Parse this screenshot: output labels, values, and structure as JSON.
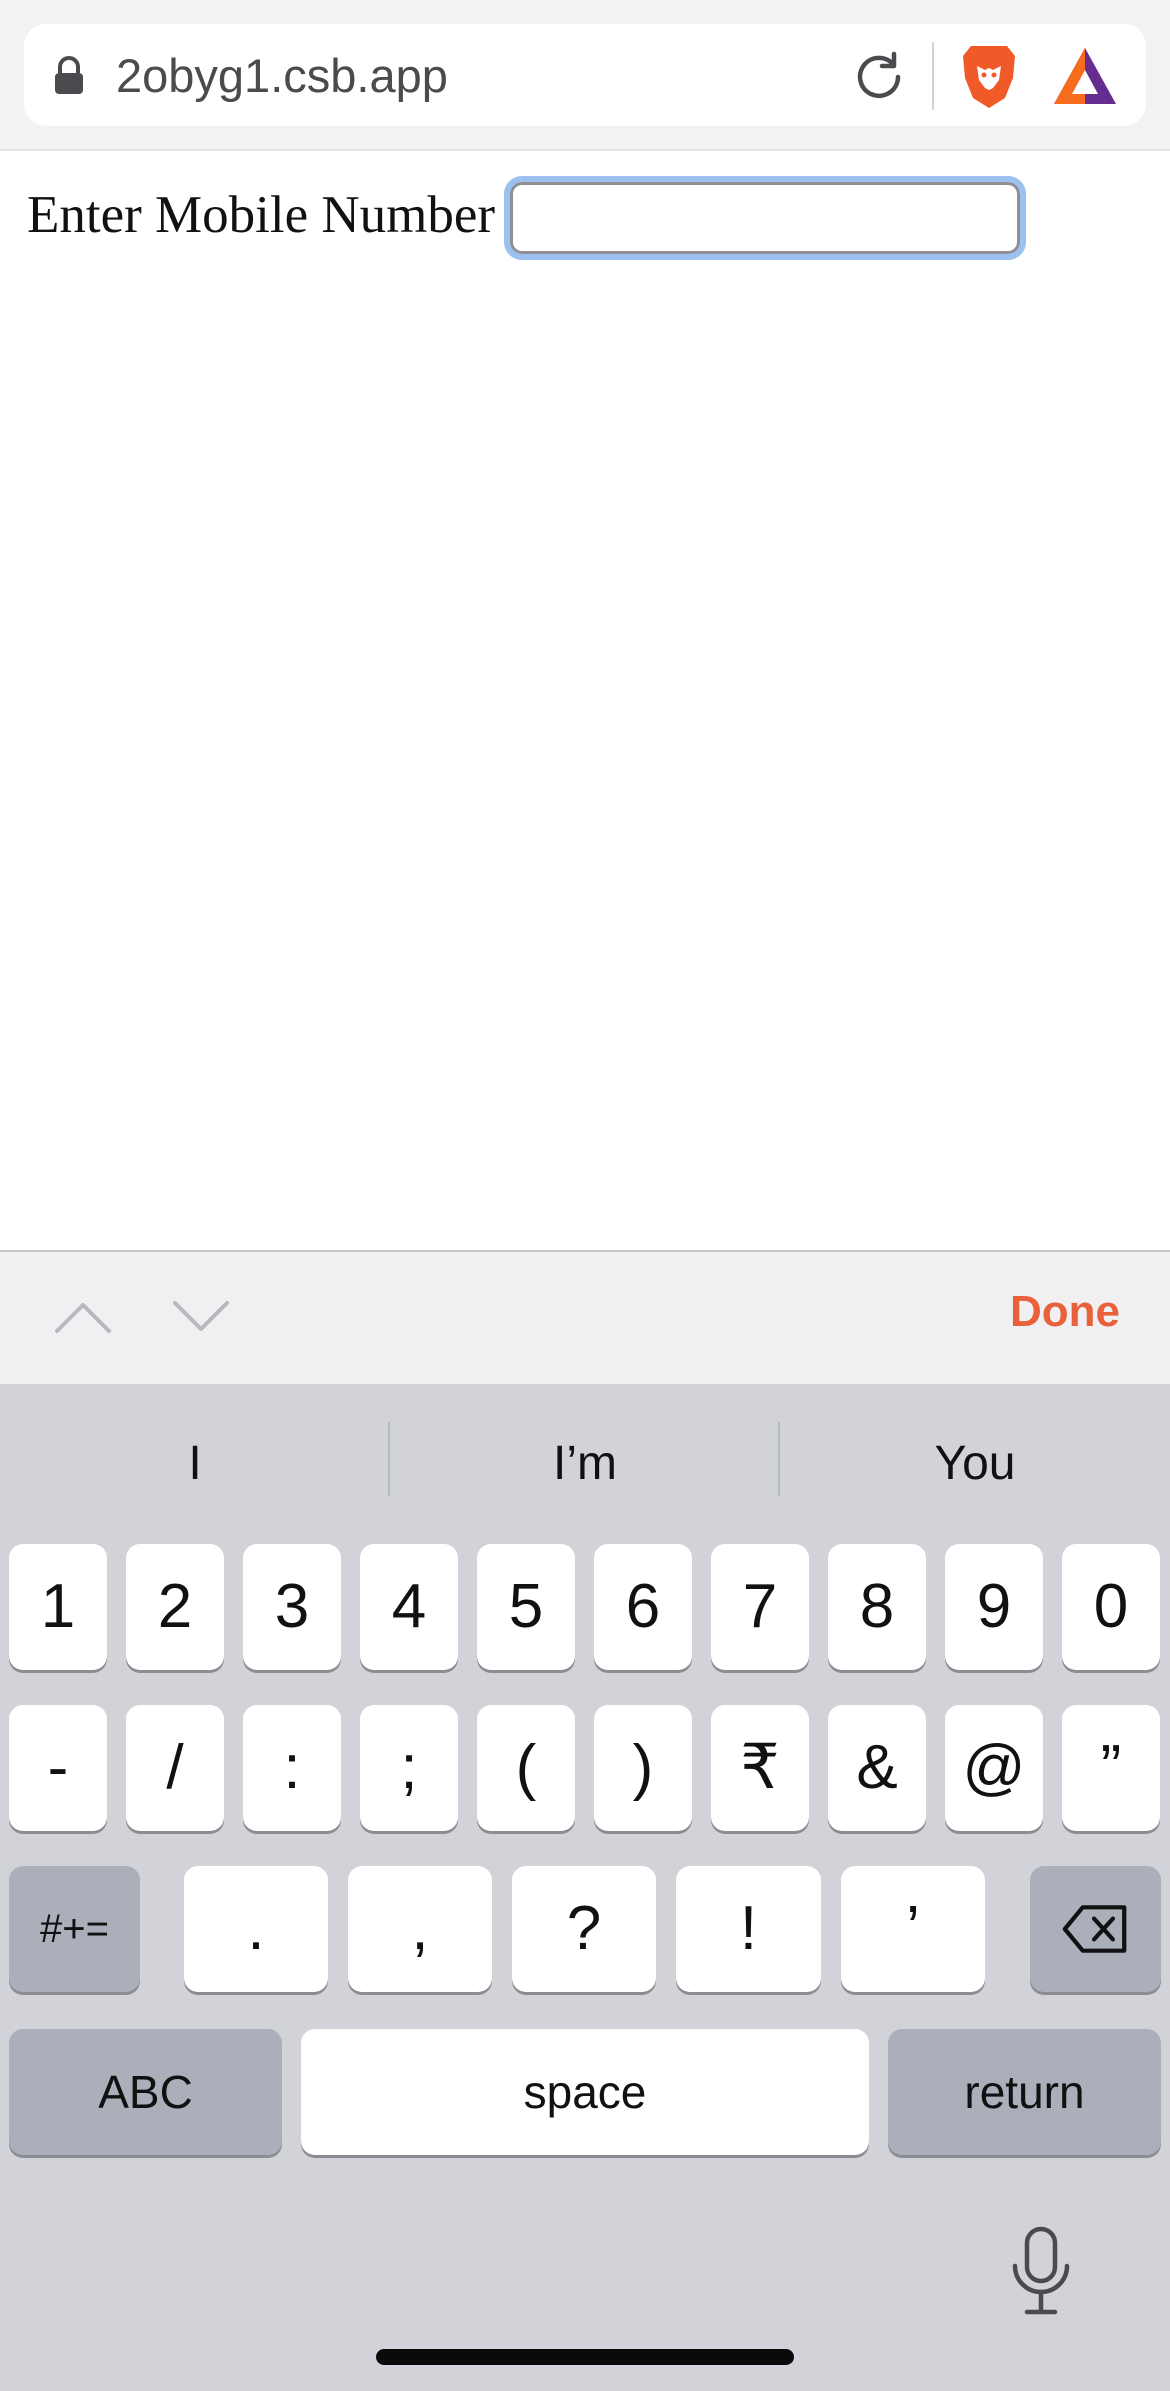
{
  "browser": {
    "url": "2obyg1.csb.app",
    "icons": [
      "lock-icon",
      "reload-icon",
      "brave-lion-icon",
      "bat-triangle-icon"
    ],
    "brand_colors": {
      "brave": "#f05a28",
      "bat_left": "#f76b1c",
      "bat_right": "#662d91"
    }
  },
  "page": {
    "field_label": "Enter Mobile Number",
    "field_value": ""
  },
  "accessory_bar": {
    "done_label": "Done",
    "done_color": "#e8613a",
    "icons": [
      "chevron-up-icon",
      "chevron-down-icon"
    ]
  },
  "keyboard": {
    "suggestions": [
      "I",
      "I’m",
      "You"
    ],
    "row1": [
      "1",
      "2",
      "3",
      "4",
      "5",
      "6",
      "7",
      "8",
      "9",
      "0"
    ],
    "row2": [
      "-",
      "/",
      ":",
      ";",
      "(",
      ")",
      "₹",
      "&",
      "@",
      "”"
    ],
    "row3_mode": "#+=",
    "row3": [
      ".",
      ",",
      "?",
      "!",
      "’"
    ],
    "row4": {
      "abc": "ABC",
      "space": "space",
      "return": "return"
    },
    "icons": [
      "backspace-icon",
      "microphone-icon"
    ]
  }
}
